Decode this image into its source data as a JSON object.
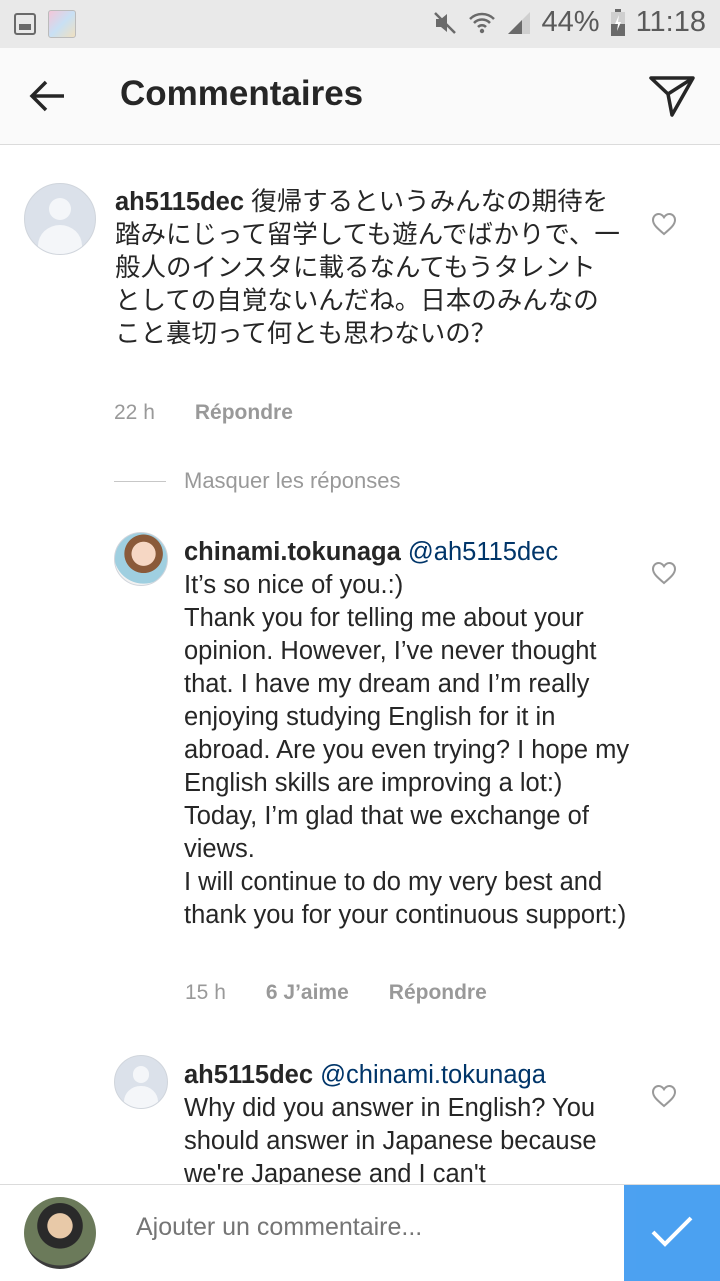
{
  "status_bar": {
    "battery": "44%",
    "time": "11:18",
    "icons": [
      "gallery-icon",
      "thumbnail-icon",
      "mute-icon",
      "wifi-icon",
      "signal-icon",
      "battery-icon"
    ]
  },
  "header": {
    "title": "Commentaires",
    "back_icon": "back-arrow-icon",
    "send_icon": "send-icon"
  },
  "comments": [
    {
      "username": "ah5115dec",
      "text": " 復帰するというみんなの期待を踏みにじって留学しても遊んでばかりで、一般人のインスタに載るなんてもうタレントとしての自覚ないんだね。日本のみんなのこと裏切って何とも思わないの？",
      "time": "22 h",
      "reply": "Répondre"
    }
  ],
  "hide_replies": "Masquer les réponses",
  "replies": [
    {
      "username": "chinami.tokunaga",
      "mention": "@ah5115dec",
      "text": "It’s so nice of you.:)\nThank you for telling me about your opinion.  However, I’ve never thought that. I have my dream and I’m really enjoying studying English for it in abroad. Are you even trying? I hope my English skills are improving a lot:) Today, I’m glad that we exchange of views.\nI will continue to do my very best and thank you for your continuous support:)",
      "time": "15 h",
      "likes": "6 J’aime",
      "reply": "Répondre"
    },
    {
      "username": "ah5115dec",
      "mention": "@chinami.tokunaga",
      "text": "Why did you answer in English? You should answer in Japanese because we're Japanese and I can't"
    }
  ],
  "composer": {
    "placeholder": "Ajouter un commentaire...",
    "post_icon": "checkmark-icon"
  },
  "colors": {
    "mention": "#003569",
    "post_button": "#3897f0",
    "meta_text": "#999999"
  }
}
